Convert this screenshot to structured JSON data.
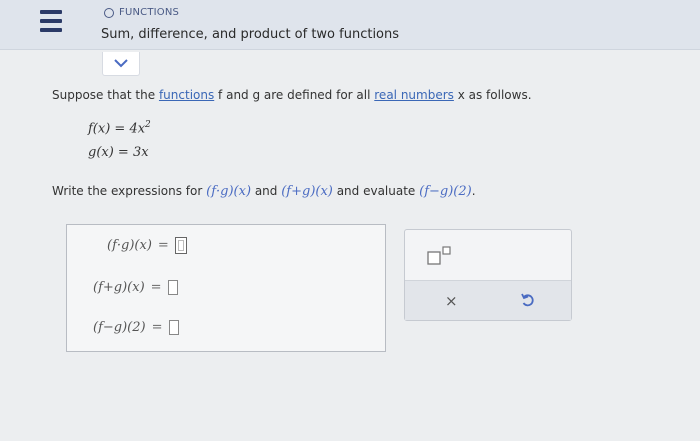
{
  "header": {
    "topic": "FUNCTIONS",
    "title": "Sum, difference, and product of two functions"
  },
  "question": {
    "intro_1": "Suppose that the ",
    "link_functions": "functions",
    "intro_2": " f and g are defined for all ",
    "link_real_numbers": "real numbers",
    "intro_3": " x as follows."
  },
  "definitions": {
    "f": "f(x) = 4x",
    "f_exp": "2",
    "g": "g(x) = 3x"
  },
  "instruction": {
    "text_1": "Write the expressions for ",
    "expr_1": "(f·g)(x)",
    "text_2": " and ",
    "expr_2": "(f+g)(x)",
    "text_3": " and evaluate ",
    "expr_3": "(f−g)(2)",
    "text_4": "."
  },
  "answers": [
    {
      "label": "(f·g)(x)",
      "sign": "=",
      "value": ""
    },
    {
      "label": "(f+g)(x)",
      "sign": "=",
      "value": ""
    },
    {
      "label": "(f−g)(2)",
      "sign": "=",
      "value": ""
    }
  ],
  "tools": {
    "clear": "×"
  },
  "colors": {
    "header_bg": "#dfe4ec",
    "link": "#3a67b6",
    "accent": "#4a6bc2"
  }
}
